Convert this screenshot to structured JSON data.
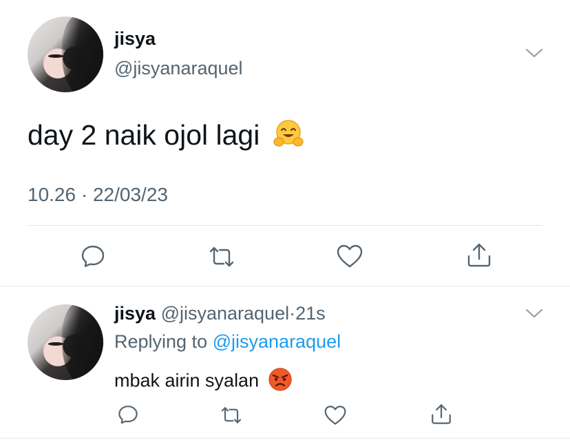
{
  "main_tweet": {
    "display_name": "jisya",
    "handle": "@jisyanaraquel",
    "text": "day 2 naik ojol lagi",
    "emoji": "hugging-face-emoji",
    "time": "10.26",
    "separator": "·",
    "date": "22/03/23"
  },
  "reply_tweet": {
    "display_name": "jisya",
    "handle": "@jisyanaraquel",
    "dot": "·",
    "age": "21s",
    "replying_prefix": "Replying to",
    "replying_handle": "@jisyanaraquel",
    "text": "mbak airin syalan",
    "emoji": "angry-face-emoji"
  },
  "colors": {
    "text": "#0f1419",
    "secondary": "#536471",
    "link": "#1d9bf0",
    "divider": "#e1e6ea",
    "icon": "#536471"
  },
  "icons": [
    "chevron-down-icon",
    "reply-icon",
    "retweet-icon",
    "like-icon",
    "share-icon"
  ]
}
